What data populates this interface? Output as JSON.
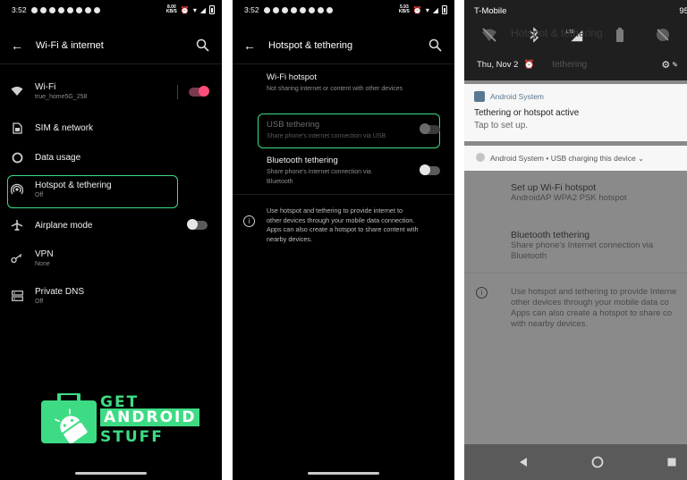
{
  "phone1": {
    "status": {
      "time": "3:52",
      "speed_top": "8.00",
      "speed_bottom": "KB/S"
    },
    "appbar": {
      "title": "Wi-Fi & internet"
    },
    "items": [
      {
        "label": "Wi-Fi",
        "sub": "true_home5G_258",
        "icon": "wifi-icon"
      },
      {
        "label": "SIM & network",
        "sub": "",
        "icon": "sim-card-icon"
      },
      {
        "label": "Data usage",
        "sub": "",
        "icon": "data-usage-icon"
      },
      {
        "label": "Hotspot & tethering",
        "sub": "Off",
        "icon": "hotspot-icon"
      },
      {
        "label": "Airplane mode",
        "sub": "",
        "icon": "airplane-icon"
      },
      {
        "label": "VPN",
        "sub": "None",
        "icon": "vpn-key-icon"
      },
      {
        "label": "Private DNS",
        "sub": "Off",
        "icon": "dns-icon"
      }
    ],
    "toggles": {
      "wifi": true,
      "airplane": false
    }
  },
  "watermark": {
    "line1": "GET",
    "line2": "ANDROID",
    "line3": "STUFF"
  },
  "phone2": {
    "status": {
      "time": "3:52",
      "speed_top": "5.93",
      "speed_bottom": "KB/S"
    },
    "appbar": {
      "title": "Hotspot & tethering"
    },
    "items": [
      {
        "title": "Wi-Fi hotspot",
        "sub": "Not sharing internet or content with other devices"
      },
      {
        "title": "USB tethering",
        "sub": "Share phone's internet connection via USB"
      },
      {
        "title": "Bluetooth tethering",
        "sub_line1": "Share phone's internet connection via",
        "sub_line2": "Bluetooth"
      }
    ],
    "info": [
      "Use hotspot and tethering to provide internet to",
      "other devices through your mobile data connection.",
      "Apps can also create a hotspot to share content with",
      "nearby devices."
    ],
    "toggles": {
      "usb": false,
      "bluetooth": false
    }
  },
  "phone3": {
    "carrier": "T-Mobile",
    "battery": "95",
    "date": "Thu, Nov 2",
    "behind_title": "Hotspot & tethering",
    "behind_tethering": "tethering",
    "notification": {
      "app": "Android System",
      "title": "Tethering or hotspot active",
      "text": "Tap to set up."
    },
    "notification2": {
      "app": "Android System",
      "text": "USB charging this device"
    },
    "behind": {
      "hotspot_title": "Set up Wi-Fi hotspot",
      "hotspot_sub": "AndroidAP WPA2 PSK hotspot",
      "bt_title": "Bluetooth tethering",
      "bt_sub1": "Share phone's Internet connection via",
      "bt_sub2": "Bluetooth",
      "info": [
        "Use hotspot and tethering to provide Interne",
        "other devices through your mobile data co",
        "Apps can also create a hotspot to share co",
        "with nearby devices."
      ]
    }
  },
  "colors": {
    "accent_green": "#3ddc84",
    "toggle_pink": "#ff4d7a"
  }
}
